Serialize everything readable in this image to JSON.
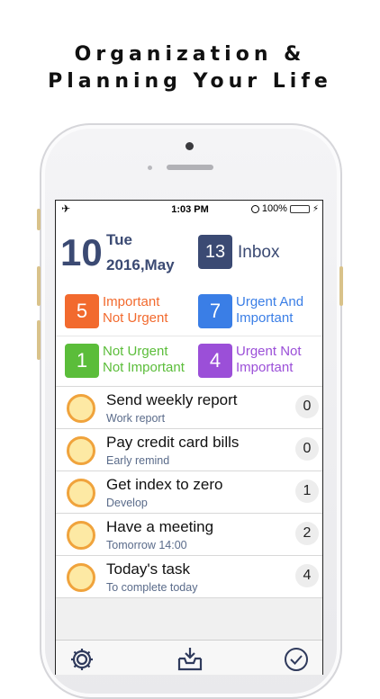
{
  "headline": {
    "line1": "Organization &",
    "line2": "Planning Your Life"
  },
  "statusbar": {
    "time": "1:03 PM",
    "battery": "100%",
    "battery_level": 1.0
  },
  "date": {
    "day": "10",
    "weekday": "Tue",
    "year_month": "2016,May"
  },
  "inbox": {
    "count": "13",
    "label": "Inbox"
  },
  "quadrants": [
    {
      "count": "5",
      "line1": "Important",
      "line2": "Not Urgent",
      "color": "#f26a2e"
    },
    {
      "count": "7",
      "line1": "Urgent And",
      "line2": "Important",
      "color": "#3a7ee6"
    },
    {
      "count": "1",
      "line1": "Not Urgent",
      "line2": "Not Important",
      "color": "#5bbd3a"
    },
    {
      "count": "4",
      "line1": "Urgent Not",
      "line2": "Important",
      "color": "#9b4fd8"
    }
  ],
  "tasks": [
    {
      "title": "Send weekly report",
      "subtitle": "Work report",
      "count": "0"
    },
    {
      "title": "Pay credit card bills",
      "subtitle": "Early remind",
      "count": "0"
    },
    {
      "title": "Get index to zero",
      "subtitle": "Develop",
      "count": "1"
    },
    {
      "title": "Have a meeting",
      "subtitle": "Tomorrow 14:00",
      "count": "2"
    },
    {
      "title": "Today's task",
      "subtitle": "To complete today",
      "count": "4"
    }
  ],
  "toolbar": {
    "icons": [
      "gear-icon",
      "inbox-download-icon",
      "checkmark-circle-icon"
    ]
  },
  "colors": {
    "accent_navy": "#3b4a73",
    "task_circle_fill": "#fde9a4",
    "task_circle_border": "#f0a33c"
  }
}
